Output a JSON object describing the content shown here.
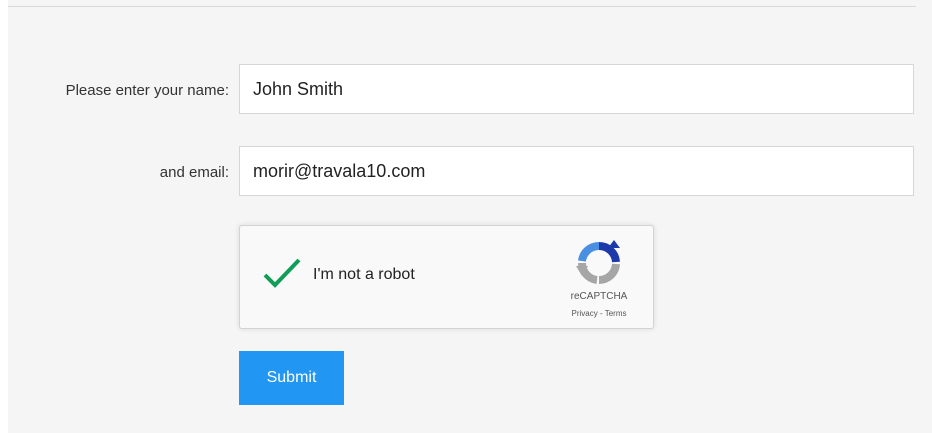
{
  "form": {
    "name_label": "Please enter your name:",
    "name_value": "John Smith",
    "email_label": "and email:",
    "email_value": "morir@travala10.com",
    "submit_label": "Submit"
  },
  "captcha": {
    "checked": true,
    "label": "I'm not a robot",
    "brand": "reCAPTCHA",
    "privacy_link": "Privacy",
    "separator": " - ",
    "terms_link": "Terms"
  },
  "colors": {
    "accent": "#2196f3",
    "check": "#0f9d58",
    "background": "#f5f5f5"
  },
  "icons": [
    "checkmark-icon",
    "recaptcha-logo-icon"
  ]
}
